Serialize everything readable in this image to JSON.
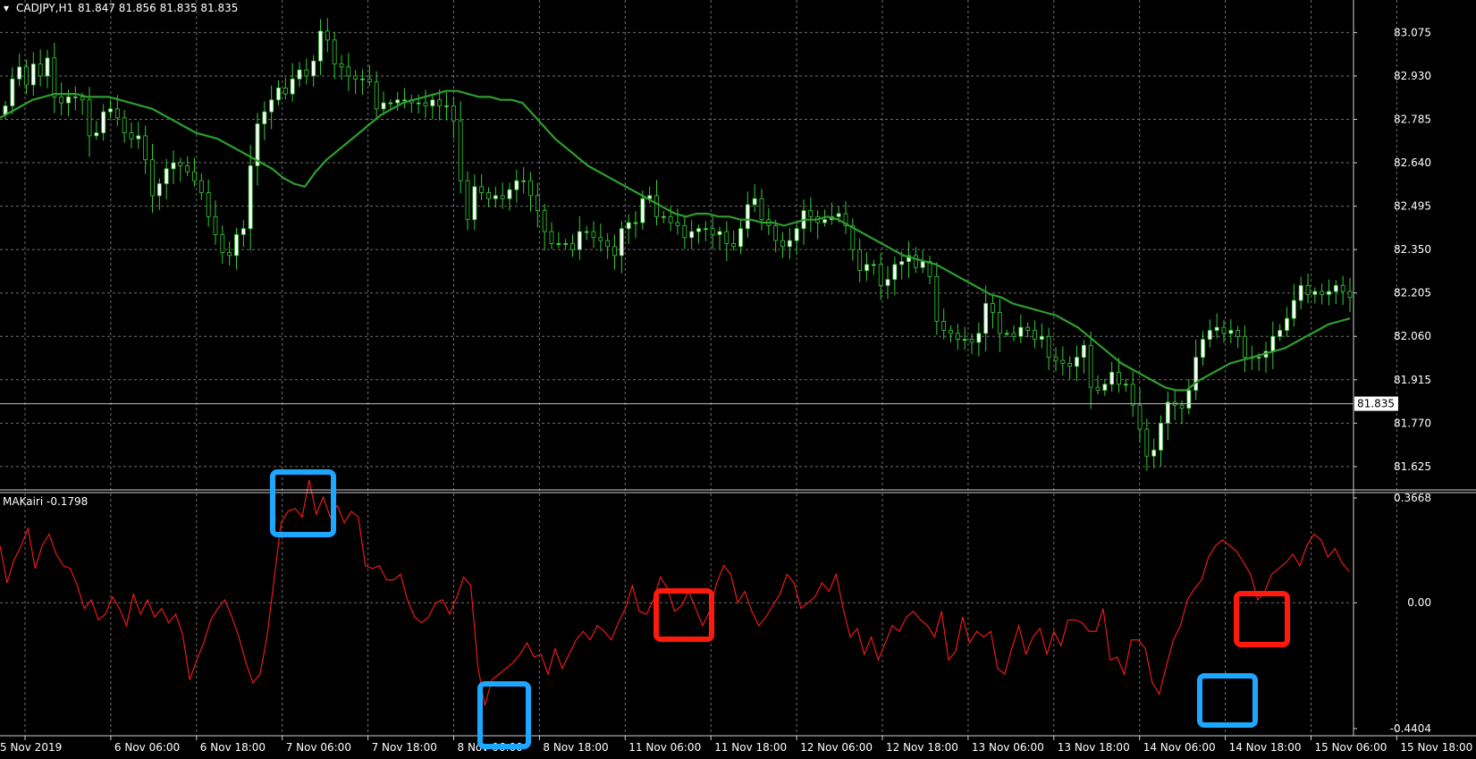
{
  "header": {
    "symbol": "CADJPY,H1",
    "ohlc": "81.847 81.856 81.835 81.835"
  },
  "indicator": {
    "label": "MAKairi -0.1798"
  },
  "current_price_label": "81.835",
  "colors": {
    "background": "#000000",
    "grid": "#6e6e6e",
    "bull_candle": "#ffffff",
    "bear_candle": "#000000",
    "candle_outline": "#33cc33",
    "moving_average": "#2e9e2e",
    "indicator_line": "#ff1a1a",
    "highlight_blue": "#1ea7ff",
    "highlight_red": "#ff1a0d",
    "axis_text": "#ffffff"
  },
  "chart_data": [
    {
      "type": "candlestick",
      "ylim": [
        81.55,
        83.13
      ],
      "y_ticks": [
        "83.075",
        "82.930",
        "82.785",
        "82.640",
        "82.495",
        "82.350",
        "82.205",
        "82.060",
        "81.915",
        "81.770",
        "81.625"
      ],
      "current_price": 81.835,
      "x_ticks": [
        "5 Nov 2019",
        "6 Nov 06:00",
        "6 Nov 18:00",
        "7 Nov 06:00",
        "7 Nov 18:00",
        "8 Nov 06:00",
        "8 Nov 18:00",
        "11 Nov 06:00",
        "11 Nov 18:00",
        "12 Nov 06:00",
        "12 Nov 18:00",
        "13 Nov 06:00",
        "13 Nov 18:00",
        "14 Nov 06:00",
        "14 Nov 18:00",
        "15 Nov 06:00",
        "15 Nov 18:00"
      ],
      "close": [
        82.83,
        82.92,
        82.96,
        82.9,
        82.97,
        82.93,
        82.99,
        82.86,
        82.84,
        82.86,
        82.86,
        82.85,
        82.73,
        82.74,
        82.81,
        82.82,
        82.79,
        82.74,
        82.72,
        82.73,
        82.65,
        82.53,
        82.57,
        82.62,
        82.64,
        82.63,
        82.61,
        82.58,
        82.54,
        82.46,
        82.4,
        82.34,
        82.33,
        82.4,
        82.42,
        82.63,
        82.77,
        82.81,
        82.85,
        82.89,
        82.87,
        82.92,
        82.95,
        82.93,
        82.98,
        83.08,
        83.05,
        82.97,
        82.96,
        82.93,
        82.92,
        82.92,
        82.91,
        82.82,
        82.84,
        82.84,
        82.85,
        82.85,
        82.84,
        82.84,
        82.83,
        82.85,
        82.83,
        82.83,
        82.78,
        82.58,
        82.45,
        82.56,
        82.54,
        82.52,
        82.53,
        82.52,
        82.55,
        82.58,
        82.58,
        82.53,
        82.48,
        82.41,
        82.37,
        82.37,
        82.37,
        82.35,
        82.41,
        82.41,
        82.39,
        82.38,
        82.36,
        82.33,
        82.42,
        82.44,
        82.44,
        82.52,
        82.53,
        82.46,
        82.46,
        82.44,
        82.43,
        82.39,
        82.41,
        82.42,
        82.42,
        82.4,
        82.41,
        82.37,
        82.36,
        82.42,
        82.5,
        82.52,
        82.45,
        82.43,
        82.38,
        82.36,
        82.38,
        82.42,
        82.48,
        82.46,
        82.44,
        82.45,
        82.46,
        82.47,
        82.43,
        82.35,
        82.28,
        82.3,
        82.3,
        82.23,
        82.25,
        82.3,
        82.31,
        82.33,
        82.29,
        82.31,
        82.26,
        82.11,
        82.08,
        82.07,
        82.05,
        82.05,
        82.04,
        82.07,
        82.17,
        82.14,
        82.07,
        82.07,
        82.06,
        82.09,
        82.08,
        82.05,
        82.06,
        81.99,
        81.98,
        81.97,
        81.96,
        81.99,
        82.03,
        81.89,
        81.88,
        81.9,
        81.94,
        81.9,
        81.9,
        81.83,
        81.75,
        81.66,
        81.68,
        81.77,
        81.84,
        81.83,
        81.82,
        81.88,
        81.99,
        82.05,
        82.08,
        82.09,
        82.07,
        82.08,
        82.06,
        81.99,
        81.99,
        81.99,
        82.01,
        82.06,
        82.08,
        82.12,
        82.18,
        82.23,
        82.2,
        82.21,
        82.2,
        82.21,
        82.23,
        82.21,
        82.19
      ],
      "moving_average": [
        82.79,
        82.81,
        82.83,
        82.85,
        82.86,
        82.87,
        82.87,
        82.87,
        82.86,
        82.86,
        82.86,
        82.85,
        82.84,
        82.83,
        82.82,
        82.8,
        82.78,
        82.76,
        82.74,
        82.73,
        82.72,
        82.7,
        82.68,
        82.66,
        82.64,
        82.62,
        82.59,
        82.57,
        82.56,
        82.61,
        82.65,
        82.68,
        82.71,
        82.74,
        82.77,
        82.8,
        82.82,
        82.84,
        82.85,
        82.86,
        82.87,
        82.88,
        82.88,
        82.87,
        82.86,
        82.86,
        82.85,
        82.85,
        82.84,
        82.8,
        82.76,
        82.72,
        82.69,
        82.66,
        82.63,
        82.61,
        82.59,
        82.57,
        82.55,
        82.53,
        82.51,
        82.49,
        82.47,
        82.46,
        82.47,
        82.47,
        82.46,
        82.46,
        82.45,
        82.45,
        82.44,
        82.44,
        82.43,
        82.44,
        82.45,
        82.45,
        82.46,
        82.45,
        82.43,
        82.41,
        82.39,
        82.37,
        82.35,
        82.33,
        82.32,
        82.31,
        82.3,
        82.28,
        82.26,
        82.24,
        82.22,
        82.2,
        82.19,
        82.17,
        82.16,
        82.15,
        82.14,
        82.13,
        82.11,
        82.09,
        82.06,
        82.03,
        82.0,
        81.97,
        81.95,
        81.93,
        81.91,
        81.89,
        81.88,
        81.88,
        81.91,
        81.93,
        81.95,
        81.97,
        81.98,
        81.99,
        82.0,
        82.01,
        82.02,
        82.04,
        82.06,
        82.08,
        82.1,
        82.11,
        82.12
      ]
    },
    {
      "type": "line",
      "name": "MAKairi",
      "ylim": [
        -0.4404,
        0.3668
      ],
      "y_ticks": [
        "0.3668",
        "0.00",
        "-0.4404"
      ],
      "y": [
        0.2,
        0.07,
        0.15,
        0.2,
        0.26,
        0.12,
        0.2,
        0.24,
        0.17,
        0.13,
        0.12,
        0.06,
        -0.02,
        0.01,
        -0.06,
        -0.04,
        0.02,
        -0.02,
        -0.08,
        0.03,
        -0.04,
        0.01,
        -0.05,
        -0.02,
        -0.07,
        -0.04,
        -0.11,
        -0.27,
        -0.2,
        -0.14,
        -0.06,
        -0.02,
        0.01,
        -0.05,
        -0.12,
        -0.21,
        -0.28,
        -0.25,
        -0.12,
        0.08,
        0.28,
        0.32,
        0.33,
        0.3,
        0.43,
        0.31,
        0.37,
        0.3,
        0.34,
        0.28,
        0.32,
        0.3,
        0.13,
        0.12,
        0.13,
        0.08,
        0.08,
        0.1,
        0.01,
        -0.05,
        -0.07,
        -0.05,
        0.0,
        0.01,
        -0.04,
        0.02,
        0.09,
        0.06,
        -0.22,
        -0.36,
        -0.27,
        -0.25,
        -0.23,
        -0.21,
        -0.18,
        -0.14,
        -0.19,
        -0.18,
        -0.25,
        -0.16,
        -0.23,
        -0.18,
        -0.13,
        -0.1,
        -0.13,
        -0.08,
        -0.1,
        -0.13,
        -0.07,
        -0.02,
        0.06,
        -0.03,
        -0.04,
        0.01,
        0.09,
        0.05,
        -0.03,
        -0.01,
        0.04,
        -0.02,
        -0.08,
        -0.03,
        0.07,
        0.13,
        0.1,
        0.0,
        0.04,
        -0.03,
        -0.08,
        -0.05,
        -0.01,
        0.03,
        0.1,
        0.07,
        -0.02,
        0.0,
        0.02,
        0.07,
        0.04,
        0.1,
        -0.02,
        -0.12,
        -0.09,
        -0.18,
        -0.12,
        -0.2,
        -0.14,
        -0.08,
        -0.1,
        -0.05,
        -0.03,
        -0.06,
        -0.08,
        -0.12,
        -0.03,
        -0.2,
        -0.17,
        -0.05,
        -0.14,
        -0.1,
        -0.12,
        -0.1,
        -0.23,
        -0.25,
        -0.16,
        -0.08,
        -0.18,
        -0.12,
        -0.09,
        -0.18,
        -0.1,
        -0.15,
        -0.06,
        -0.06,
        -0.07,
        -0.1,
        -0.1,
        -0.02,
        -0.2,
        -0.19,
        -0.25,
        -0.13,
        -0.13,
        -0.16,
        -0.28,
        -0.32,
        -0.22,
        -0.13,
        -0.08,
        0.01,
        0.05,
        0.08,
        0.16,
        0.2,
        0.22,
        0.2,
        0.18,
        0.14,
        0.1,
        0.01,
        0.04,
        0.1,
        0.12,
        0.14,
        0.17,
        0.13,
        0.2,
        0.24,
        0.22,
        0.16,
        0.19,
        0.14,
        0.11
      ]
    }
  ]
}
